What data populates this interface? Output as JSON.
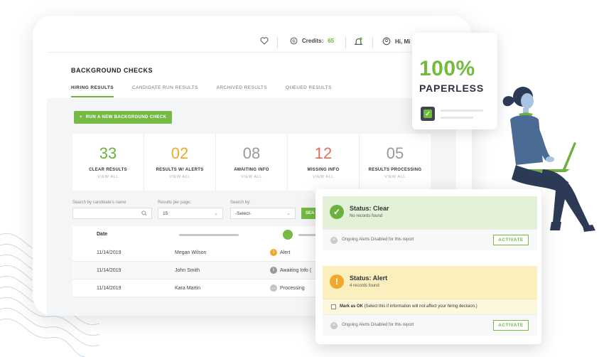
{
  "topbar": {
    "credits_label": "Credits:",
    "credits_value": "65",
    "greeting": "Hi, Mi"
  },
  "page": {
    "title": "BACKGROUND CHECKS",
    "tabs": [
      {
        "label": "HIRING RESULTS",
        "active": true
      },
      {
        "label": "CANDIDATE RUN RESULTS",
        "active": false
      },
      {
        "label": "ARCHIVED RESULTS",
        "active": false
      },
      {
        "label": "QUEUED RESULTS",
        "active": false
      }
    ],
    "run_button": "RUN A NEW BACKGROUND CHECK"
  },
  "stats": [
    {
      "value": "33",
      "label": "CLEAR RESULTS",
      "link": "VIEW ALL",
      "color": "#6ab23d"
    },
    {
      "value": "02",
      "label": "RESULTS  W/ ALERTS",
      "link": "VIEW ALL",
      "color": "#f0a92b"
    },
    {
      "value": "08",
      "label": "AWAITING INFO",
      "link": "VIEW ALL",
      "color": "#9a9a9a"
    },
    {
      "value": "12",
      "label": "MISSING INFO",
      "link": "VIEW ALL",
      "color": "#e0705a"
    },
    {
      "value": "05",
      "label": "RESULTS PROCESSING",
      "link": "VIEW ALL",
      "color": "#9a9a9a"
    }
  ],
  "filters": {
    "search_label": "Search by candidate's name",
    "search_placeholder": "",
    "per_page_label": "Results per page:",
    "per_page_value": "15",
    "search_by_label": "Search by:",
    "search_by_value": "-Select-",
    "search_button": "SEA"
  },
  "table": {
    "header_date": "Date",
    "rows": [
      {
        "date": "11/14/2019",
        "name": "Megan Wilson",
        "status": "Alert",
        "icon": "!",
        "icon_color": "#f0a92b"
      },
      {
        "date": "11/14/2019",
        "name": "John Smith",
        "status": "Awaiting Info (",
        "icon": "i",
        "icon_color": "#9a9a9a"
      },
      {
        "date": "11/14/2019",
        "name": "Kara Martin",
        "status": "Processing",
        "icon": "…",
        "icon_color": "#c4c4c4"
      }
    ]
  },
  "paperless": {
    "percent": "100%",
    "word": "PAPERLESS"
  },
  "status_clear": {
    "title": "Status: Clear",
    "subtitle": "No records found",
    "footer": "Ongoing Alerts Disabled for this report",
    "button": "ACTIVATE",
    "color": "#e4f1d9",
    "icon_color": "#6ab23d"
  },
  "status_alert": {
    "title": "Status: Alert",
    "subtitle": "4 records found",
    "mark_bold": "Mark as OK",
    "mark_text": "(Select this if information will not affect your hiring decision.)",
    "footer": "Ongoing Alerts Disabled for this report",
    "button": "ACTIVATE",
    "color": "#fbefbd",
    "icon_color": "#f0a92b"
  }
}
